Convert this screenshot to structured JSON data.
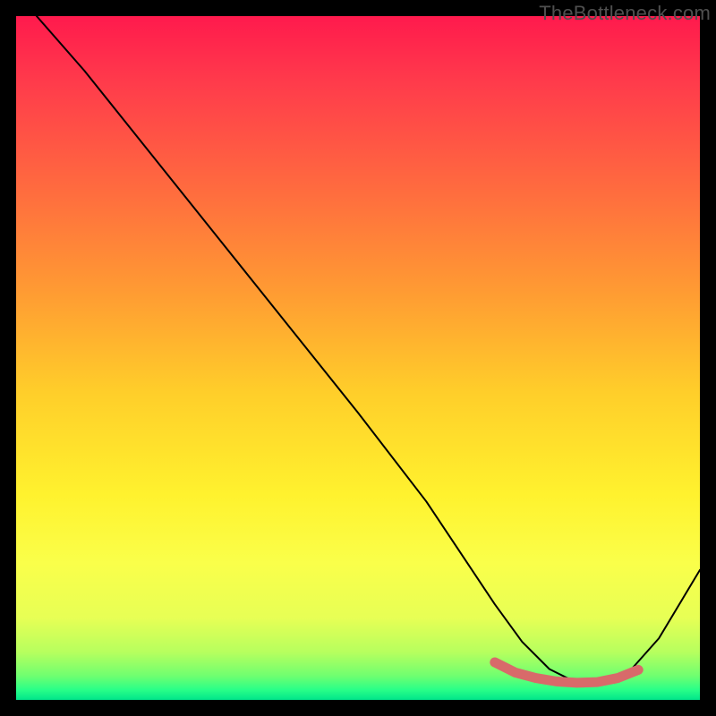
{
  "watermark": "TheBottleneck.com",
  "chart_data": {
    "type": "line",
    "title": "",
    "xlabel": "",
    "ylabel": "",
    "xlim": [
      0,
      100
    ],
    "ylim": [
      0,
      100
    ],
    "grid": false,
    "series": [
      {
        "name": "curve",
        "color": "#000000",
        "stroke_width": 2,
        "x": [
          3,
          10,
          20,
          30,
          40,
          50,
          60,
          66,
          70,
          74,
          78,
          82,
          86,
          90,
          94,
          100
        ],
        "values": [
          100,
          92,
          79.5,
          67,
          54.5,
          42,
          29,
          20,
          14,
          8.5,
          4.5,
          2.5,
          2.5,
          4.5,
          9,
          19
        ]
      },
      {
        "name": "highlight-band",
        "color": "#d86a6a",
        "stroke_width": 11,
        "x": [
          70,
          73,
          76,
          79,
          82,
          85,
          88,
          91
        ],
        "values": [
          5.5,
          4.0,
          3.2,
          2.7,
          2.5,
          2.6,
          3.2,
          4.4
        ]
      }
    ],
    "background_gradient": {
      "stops": [
        {
          "offset": 0.0,
          "color": "#ff1a4d"
        },
        {
          "offset": 0.1,
          "color": "#ff3c4b"
        },
        {
          "offset": 0.25,
          "color": "#ff6a3f"
        },
        {
          "offset": 0.4,
          "color": "#ff9a33"
        },
        {
          "offset": 0.55,
          "color": "#ffce2a"
        },
        {
          "offset": 0.7,
          "color": "#fff22e"
        },
        {
          "offset": 0.8,
          "color": "#faff4a"
        },
        {
          "offset": 0.88,
          "color": "#e7ff55"
        },
        {
          "offset": 0.93,
          "color": "#b7ff5e"
        },
        {
          "offset": 0.965,
          "color": "#6fff70"
        },
        {
          "offset": 0.985,
          "color": "#2aff88"
        },
        {
          "offset": 1.0,
          "color": "#00e58a"
        }
      ]
    }
  }
}
